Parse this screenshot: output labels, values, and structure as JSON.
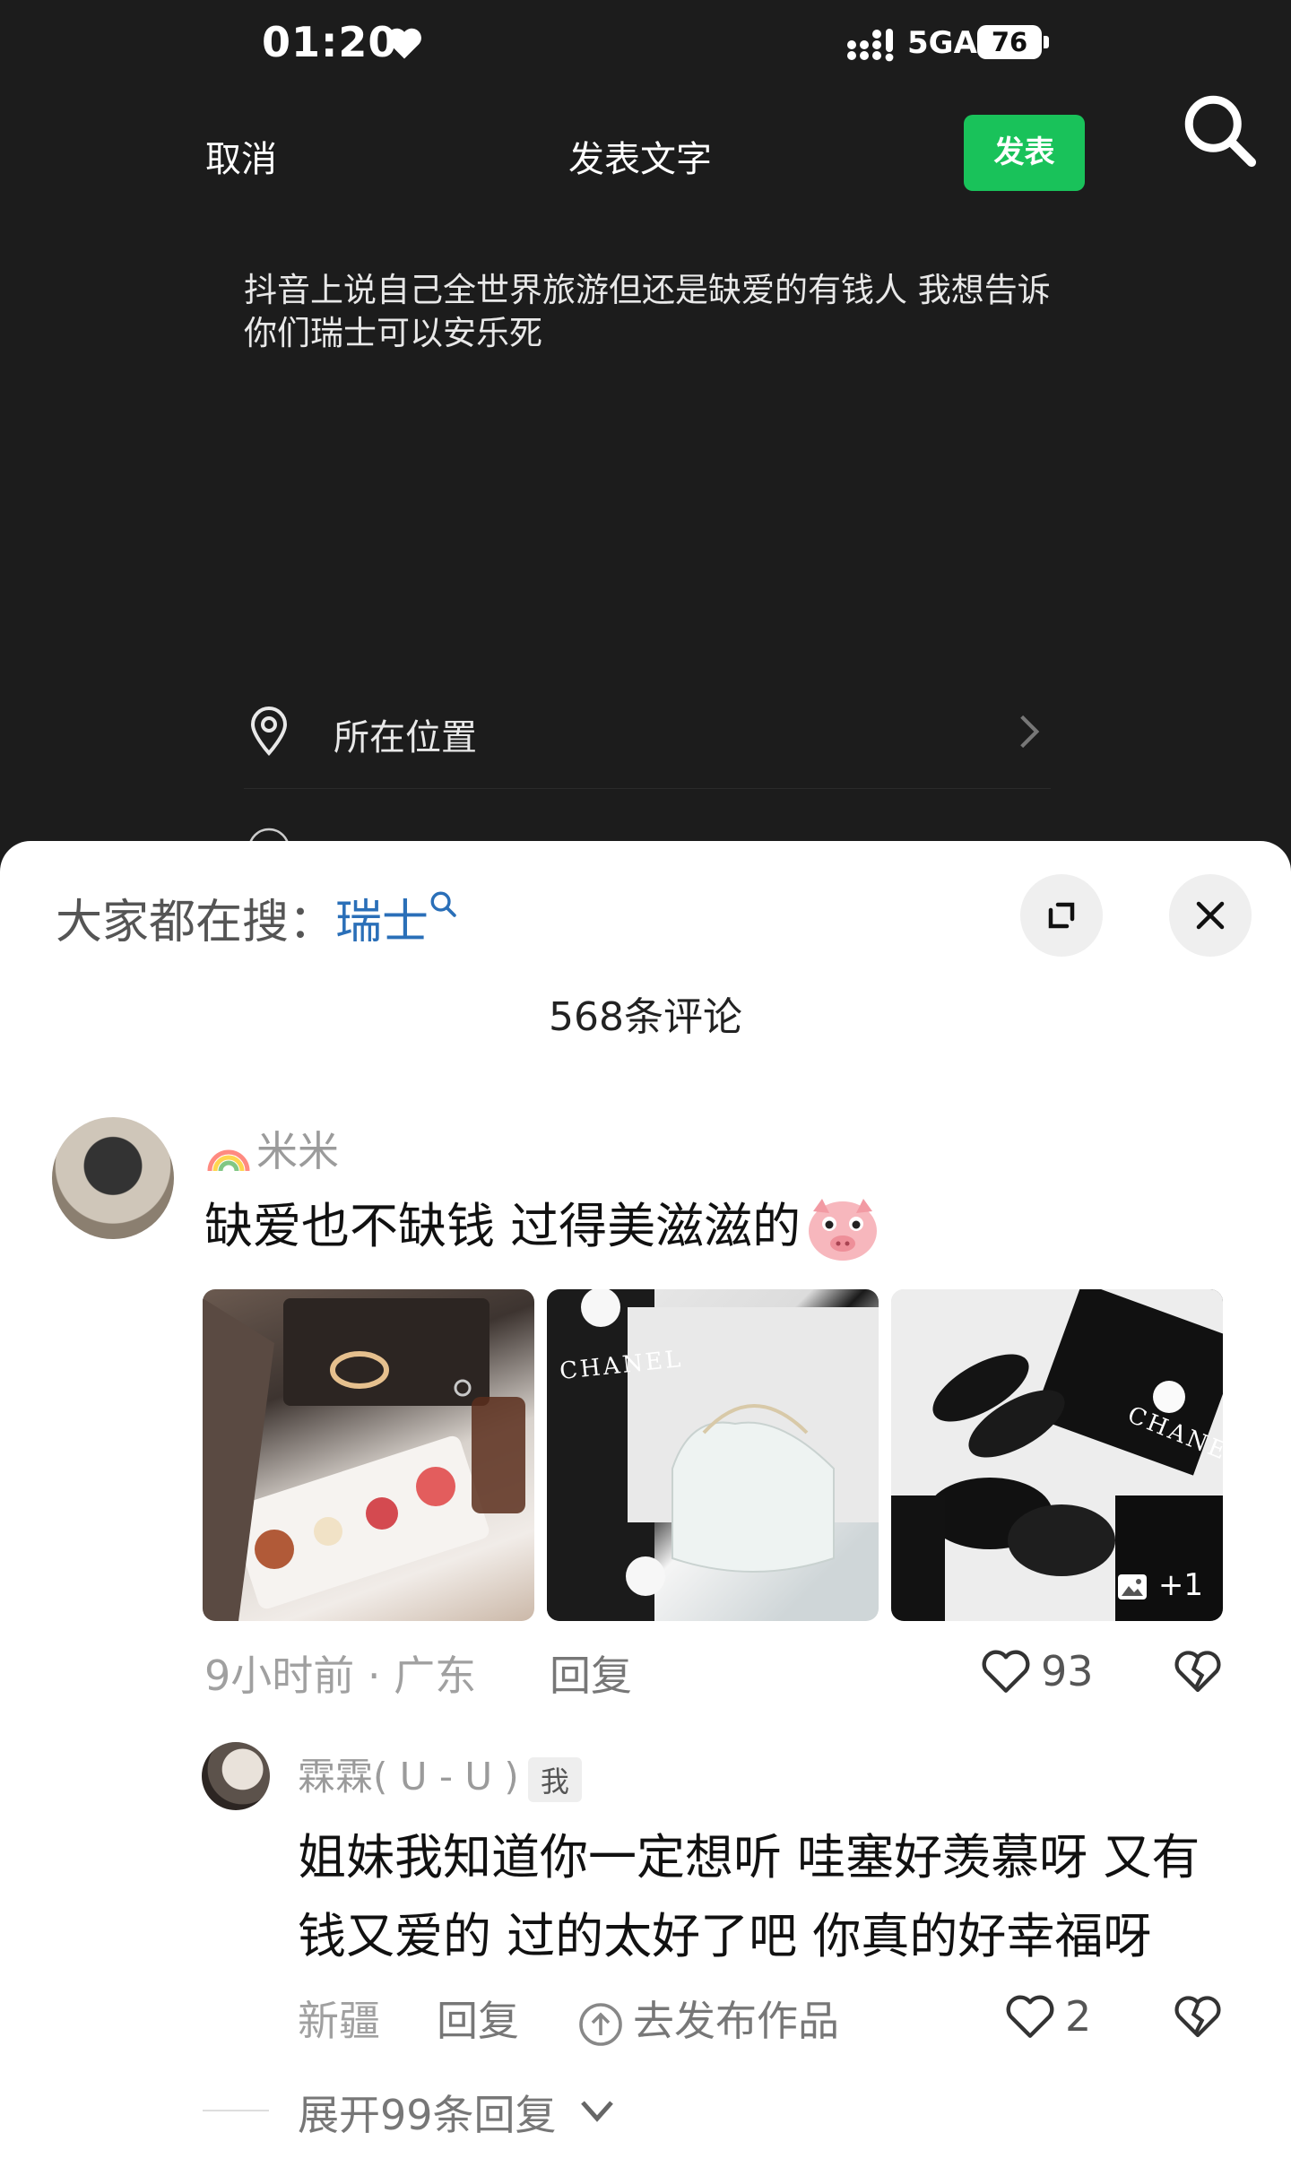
{
  "status_bar": {
    "time": "01:20",
    "network": "5GA",
    "battery": "76"
  },
  "compose": {
    "cancel_label": "取消",
    "title": "发表文字",
    "publish_label": "发表",
    "post_text": "抖音上说自己全世界旅游但还是缺爱的有钱人 我想告诉你们瑞士可以安乐死",
    "location_label": "所在位置"
  },
  "comments_sheet": {
    "hot_search_prefix": "大家都在搜：",
    "hot_search_keyword": "瑞士",
    "comment_count": "568条评论",
    "comment": {
      "username": "米米",
      "text": "缺爱也不缺钱 过得美滋滋的",
      "images": [
        {
          "label": ""
        },
        {
          "label": "CHANEL"
        },
        {
          "label": "CHANEL",
          "more": "+1"
        }
      ],
      "time": "9小时前",
      "location": "广东",
      "reply_label": "回复",
      "likes": "93"
    },
    "reply": {
      "username": "霖霖( ᑌ - ᑌ )",
      "me_tag": "我",
      "text": "姐妹我知道你一定想听 哇塞好羡慕呀 又有钱又爱的 过的太好了吧 你真的好幸福呀",
      "location": "新疆",
      "reply_label": "回复",
      "post_work_label": "去发布作品",
      "likes": "2"
    },
    "expand_label": "展开99条回复"
  }
}
